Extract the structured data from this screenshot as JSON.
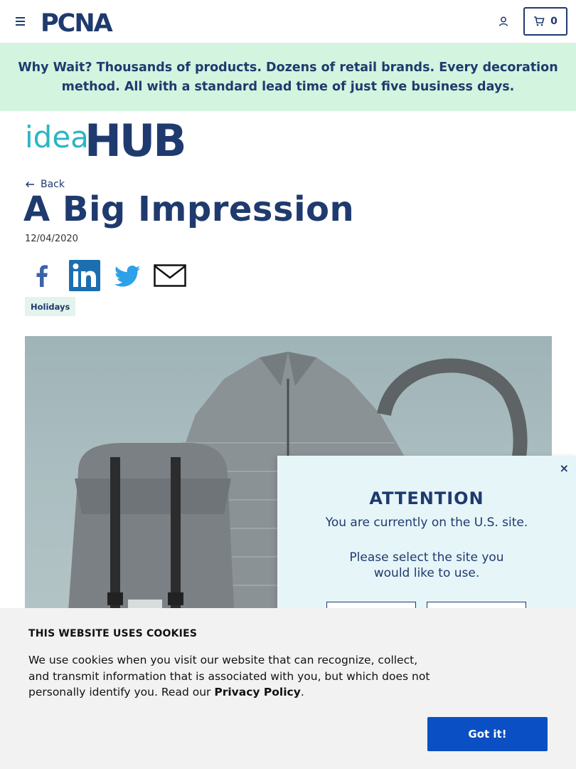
{
  "header": {
    "logo_text": "PCNA",
    "cart_count": "0"
  },
  "promo": {
    "lead": "Why Wait?",
    "text": " Thousands of products. Dozens of retail brands. Every decoration method. All with a standard lead time of just five business days."
  },
  "idea_hub": {
    "part1": "idea",
    "part2": "HUB"
  },
  "article": {
    "back_label": "Back",
    "title": "A Big Impression",
    "date": "12/04/2020",
    "tag": "Holidays"
  },
  "attention": {
    "title": "ATTENTION",
    "line1": "You are currently on the U.S. site.",
    "line2": "Please select the site you",
    "line3": "would like to use.",
    "close": "×"
  },
  "cookie": {
    "title": "THIS WEBSITE USES COOKIES",
    "text": "We use cookies when you visit our website that can recognize, collect, and transmit information that is associated with you, but which does not personally identify you. Read our ",
    "link": "Privacy Policy",
    "after": ".",
    "button": "Got it!"
  },
  "colors": {
    "brand_navy": "#1f3a6e",
    "promo_bg": "#d3f4df",
    "idea_teal": "#2bb5c4",
    "cookie_button": "#0a4fc4"
  }
}
